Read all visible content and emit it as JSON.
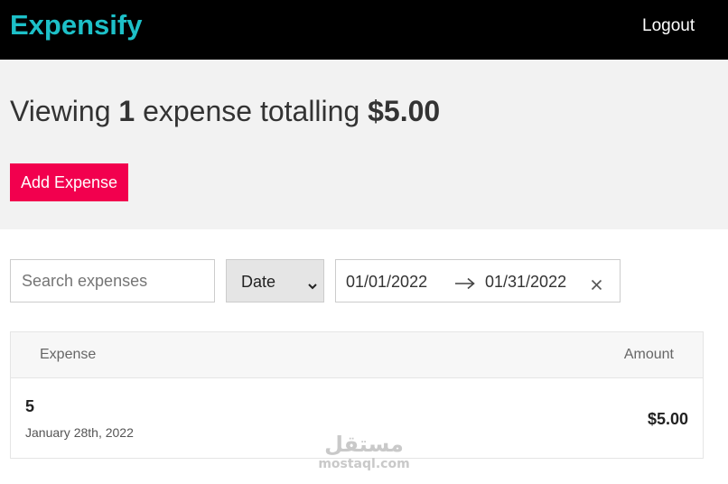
{
  "header": {
    "brand": "Expensify",
    "logout_label": "Logout"
  },
  "summary": {
    "prefix": "Viewing",
    "count": "1",
    "middle": "expense totalling",
    "total": "$5.00"
  },
  "actions": {
    "add_expense_label": "Add Expense"
  },
  "filters": {
    "search_placeholder": "Search expenses",
    "search_value": "",
    "sort_by": "Date",
    "start_date": "01/01/2022",
    "end_date": "01/31/2022"
  },
  "list": {
    "headers": {
      "expense": "Expense",
      "amount": "Amount"
    },
    "items": [
      {
        "description": "5",
        "date": "January 28th, 2022",
        "amount": "$5.00"
      }
    ]
  },
  "watermark": {
    "arabic": "مستقل",
    "latin": "mostaql.com"
  },
  "colors": {
    "brand": "#1dc0c8",
    "accent": "#f2004e",
    "header_bg": "#000000",
    "summary_bg": "#f2f2f2"
  },
  "icons": {
    "sort_chevron": "chevron-down-icon",
    "date_arrow": "arrow-right-icon",
    "date_clear": "close-icon"
  }
}
